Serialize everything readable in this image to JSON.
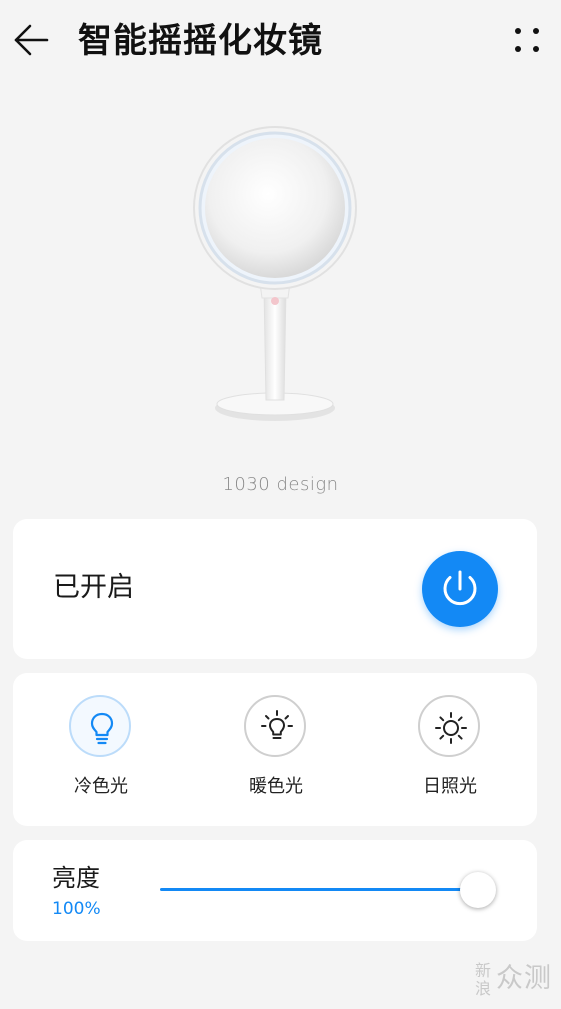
{
  "header": {
    "title": "智能摇摇化妆镜",
    "back_icon": "arrow-left-icon",
    "more_icon": "more-vertical-dots-icon"
  },
  "product": {
    "image": "round-makeup-mirror-on-stand",
    "brand": "1030 design"
  },
  "power": {
    "status": "已开启",
    "is_on": true,
    "icon": "power-icon",
    "accent_color": "#1389f5"
  },
  "modes": [
    {
      "label": "冷色光",
      "icon": "lightbulb-icon",
      "active": true
    },
    {
      "label": "暖色光",
      "icon": "lightbulb-rays-icon",
      "active": false
    },
    {
      "label": "日照光",
      "icon": "sun-icon",
      "active": false
    }
  ],
  "brightness": {
    "label": "亮度",
    "value_text": "100%",
    "level": 1.0
  },
  "watermark": {
    "small": "新浪",
    "big": "众测"
  },
  "colors": {
    "accent": "#1389f5",
    "background": "#f4f4f4",
    "card": "#ffffff"
  }
}
